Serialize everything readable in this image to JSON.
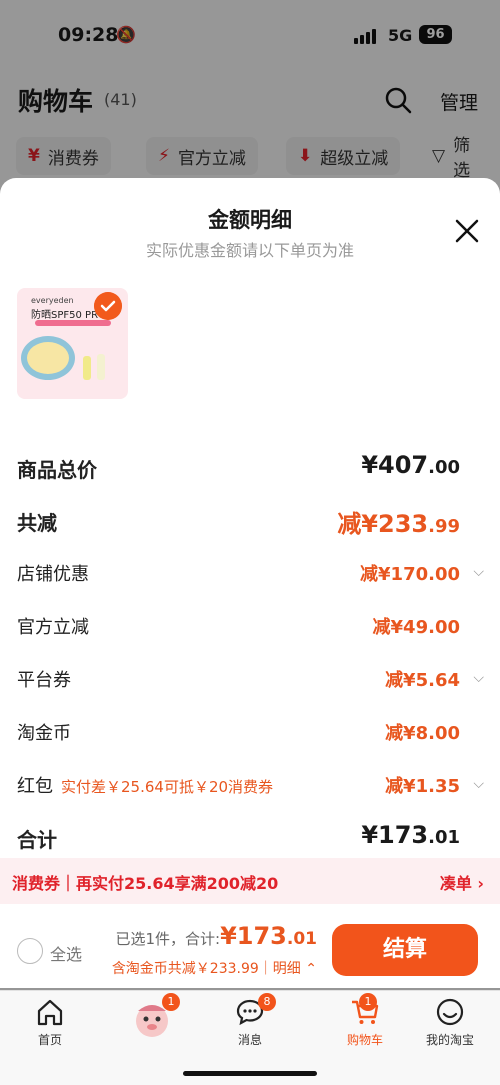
{
  "status": {
    "time": "09:28",
    "network": "5G",
    "battery": "96"
  },
  "cart": {
    "title": "购物车",
    "count": "(41)",
    "manage": "管理"
  },
  "filters": [
    "消费券",
    "官方立减",
    "超级立减",
    "筛选"
  ],
  "sheet": {
    "title": "金额明细",
    "subtitle": "实际优惠金额请以下单页为准",
    "product": {
      "brand": "everyeden",
      "line": "防晒SPF50 PRO"
    },
    "rows": [
      {
        "label": "商品总价",
        "value": "¥407",
        "decimal": ".00"
      },
      {
        "label": "共减",
        "value": "减¥233",
        "decimal": ".99"
      },
      {
        "label": "店铺优惠",
        "value": "减¥170.00"
      },
      {
        "label": "官方立减",
        "value": "减¥49.00"
      },
      {
        "label": "平台券",
        "value": "减¥5.64"
      },
      {
        "label": "淘金币",
        "value": "减¥8.00"
      },
      {
        "label": "红包",
        "hint": "实付差￥25.64可抵￥20消费券",
        "value": "减¥1.35"
      },
      {
        "label": "合计",
        "value": "¥173",
        "decimal": ".01"
      }
    ],
    "coupon_bar": {
      "text": "消费券｜再实付25.64享满200减20",
      "link": "凑单 ›"
    }
  },
  "checkout": {
    "select_all": "全选",
    "selected_text": "已选1件，合计:",
    "amount": "¥173",
    "amount_decimal": ".01",
    "sub_text": "含淘金币共减￥233.99｜明细",
    "pay_label": "结算"
  },
  "tabbar": {
    "items": [
      {
        "label": "首页",
        "badge": ""
      },
      {
        "label": "",
        "badge": "1"
      },
      {
        "label": "消息",
        "badge": "8"
      },
      {
        "label": "购物车",
        "badge": "1"
      },
      {
        "label": "我的淘宝",
        "badge": ""
      }
    ]
  },
  "colors": {
    "accent": "#f2541b",
    "discount": "#e8561f",
    "coupon_bg": "#fdeff1"
  }
}
